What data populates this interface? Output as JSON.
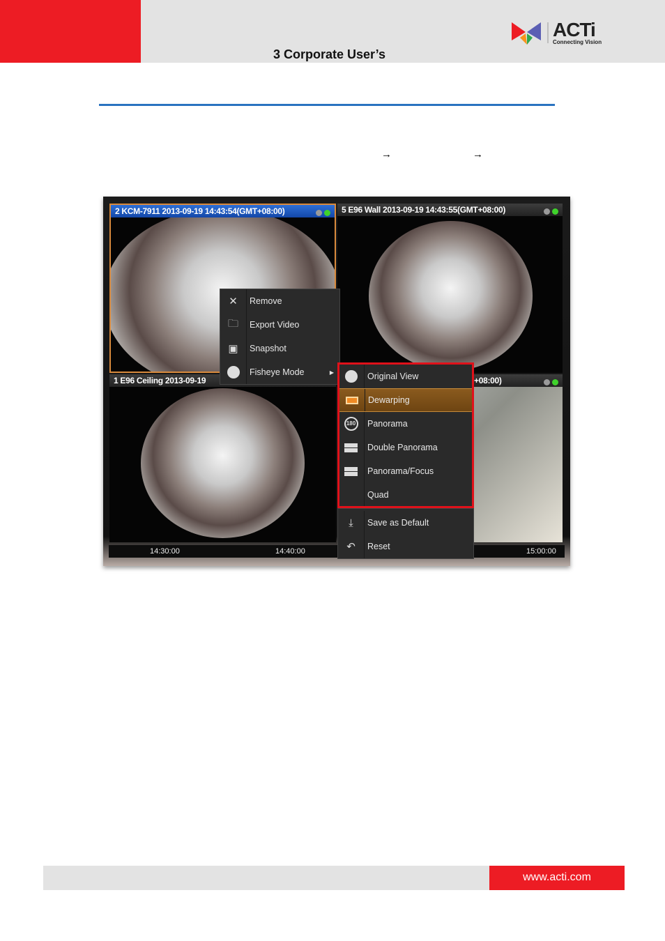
{
  "header": {
    "chapter": "3 Corporate User’s",
    "logo_text": "ACTi",
    "logo_tagline": "Connecting Vision"
  },
  "instruction": {
    "arrows": [
      "→",
      "→"
    ]
  },
  "screenshot": {
    "tiles": [
      {
        "title": "2 KCM-7911   2013-09-19 14:43:54(GMT+08:00)",
        "selected": true
      },
      {
        "title": "5 E96 Wall   2013-09-19 14:43:55(GMT+08:00)"
      },
      {
        "title": "1 E96 Ceiling   2013-09-19"
      },
      {
        "title": "+08:00)"
      }
    ],
    "status_colors": {
      "idle": "#9a9a9a",
      "live": "#3fd22b"
    },
    "timeline": [
      "14:30:00",
      "14:40:00",
      "15:00:00"
    ],
    "context_menu": [
      {
        "icon": "close-icon",
        "label": "Remove"
      },
      {
        "icon": "export-icon",
        "label": "Export Video"
      },
      {
        "icon": "camera-icon",
        "label": "Snapshot"
      },
      {
        "icon": "circle-icon",
        "label": "Fisheye Mode"
      }
    ],
    "submenu": [
      {
        "icon": "circle-icon",
        "label": "Original View"
      },
      {
        "icon": "dewarp-icon",
        "label": "Dewarping",
        "highlighted": true
      },
      {
        "icon": "panorama-180-icon",
        "label": "Panorama",
        "icon_text": "180"
      },
      {
        "icon": "double-panorama-icon",
        "label": "Double Panorama"
      },
      {
        "icon": "panorama-focus-icon",
        "label": "Panorama/Focus"
      },
      {
        "icon": "quad-icon",
        "label": "Quad"
      },
      {
        "icon": "download-icon",
        "label": "Save as Default"
      },
      {
        "icon": "undo-icon",
        "label": "Reset"
      }
    ],
    "highlight_color": "#e0111a"
  },
  "footer": {
    "url": "www.acti.com"
  }
}
